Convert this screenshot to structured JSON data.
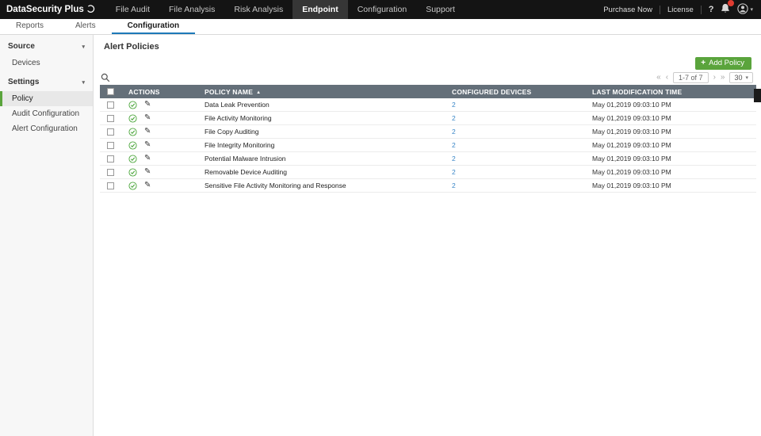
{
  "colors": {
    "accent_green": "#5aa43c",
    "table_header_bg": "#646f79",
    "link_blue": "#3a87c8",
    "badge_red": "#e03c31",
    "active_tab_blue": "#1d79b8"
  },
  "icons": {
    "plus": "+",
    "pencil": "✎",
    "sort_asc": "▲",
    "caret_down": "▾",
    "pager_first": "«",
    "pager_prev": "‹",
    "pager_next": "›",
    "pager_last": "»",
    "help": "?"
  },
  "topbar": {
    "logo": "DataSecurity Plus",
    "nav": [
      {
        "label": "File Audit"
      },
      {
        "label": "File Analysis"
      },
      {
        "label": "Risk Analysis"
      },
      {
        "label": "Endpoint"
      },
      {
        "label": "Configuration"
      },
      {
        "label": "Support"
      }
    ],
    "purchase": "Purchase Now",
    "license": "License"
  },
  "tabs": [
    {
      "label": "Reports"
    },
    {
      "label": "Alerts"
    },
    {
      "label": "Configuration"
    }
  ],
  "sidebar": {
    "sections": [
      {
        "title": "Source",
        "items": [
          {
            "label": "Devices"
          }
        ]
      },
      {
        "title": "Settings",
        "items": [
          {
            "label": "Policy"
          },
          {
            "label": "Audit Configuration"
          },
          {
            "label": "Alert Configuration"
          }
        ]
      }
    ]
  },
  "main": {
    "title": "Alert Policies",
    "add_button": "Add Policy",
    "pagination": {
      "range": "1-7 of 7",
      "page_size": "30"
    },
    "table": {
      "headers": {
        "actions": "ACTIONS",
        "policy_name": "POLICY NAME",
        "configured_devices": "CONFIGURED DEVICES",
        "last_modification_time": "LAST MODIFICATION TIME"
      },
      "rows": [
        {
          "policy": "Data Leak Prevention",
          "devices": "2",
          "modified": "May 01,2019 09:03:10 PM"
        },
        {
          "policy": "File Activity Monitoring",
          "devices": "2",
          "modified": "May 01,2019 09:03:10 PM"
        },
        {
          "policy": "File Copy Auditing",
          "devices": "2",
          "modified": "May 01,2019 09:03:10 PM"
        },
        {
          "policy": "File Integrity Monitoring",
          "devices": "2",
          "modified": "May 01,2019 09:03:10 PM"
        },
        {
          "policy": "Potential Malware Intrusion",
          "devices": "2",
          "modified": "May 01,2019 09:03:10 PM"
        },
        {
          "policy": "Removable Device Auditing",
          "devices": "2",
          "modified": "May 01,2019 09:03:10 PM"
        },
        {
          "policy": "Sensitive File Activity Monitoring and Response",
          "devices": "2",
          "modified": "May 01,2019 09:03:10 PM"
        }
      ]
    }
  }
}
